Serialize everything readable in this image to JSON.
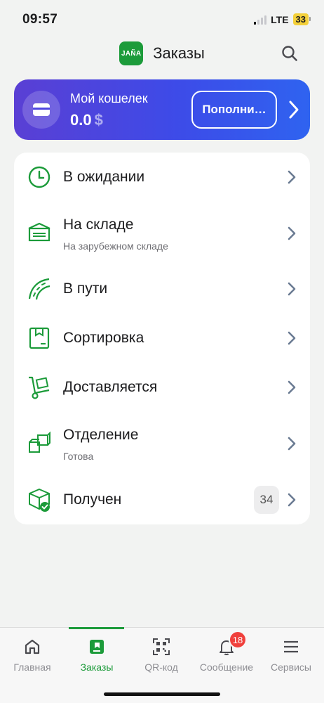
{
  "status_bar": {
    "time": "09:57",
    "network": "LTE",
    "battery": "33"
  },
  "header": {
    "logo_text": "JAÑA",
    "title": "Заказы",
    "search_icon": "search-icon"
  },
  "wallet": {
    "title": "Мой кошелек",
    "amount": "0.0",
    "currency": "$",
    "topup_label": "Пополни…",
    "icon": "wallet-icon"
  },
  "orders": [
    {
      "label": "В ожидании",
      "sub": "",
      "icon": "clock-icon"
    },
    {
      "label": "На складе",
      "sub": "На зарубежном складе",
      "icon": "warehouse-icon"
    },
    {
      "label": "В пути",
      "sub": "",
      "icon": "road-icon"
    },
    {
      "label": "Сортировка",
      "sub": "",
      "icon": "box-icon"
    },
    {
      "label": "Доставляется",
      "sub": "",
      "icon": "hand-truck-icon"
    },
    {
      "label": "Отделение",
      "sub": "Готова",
      "icon": "boxes-icon"
    },
    {
      "label": "Получен",
      "sub": "",
      "icon": "box-check-icon",
      "count": "34"
    }
  ],
  "tabbar": {
    "tabs": [
      {
        "label": "Главная",
        "icon": "home-icon",
        "active": false
      },
      {
        "label": "Заказы",
        "icon": "orders-icon",
        "active": true
      },
      {
        "label": "QR-код",
        "icon": "qr-code-icon",
        "active": false
      },
      {
        "label": "Сообщение",
        "icon": "bell-icon",
        "active": false,
        "badge": "18"
      },
      {
        "label": "Сервисы",
        "icon": "menu-icon",
        "active": false
      }
    ]
  },
  "colors": {
    "accent": "#1c9b3a",
    "wallet_start": "#5a3fd4",
    "wallet_end": "#2f63f0",
    "badge": "#f0403c"
  }
}
